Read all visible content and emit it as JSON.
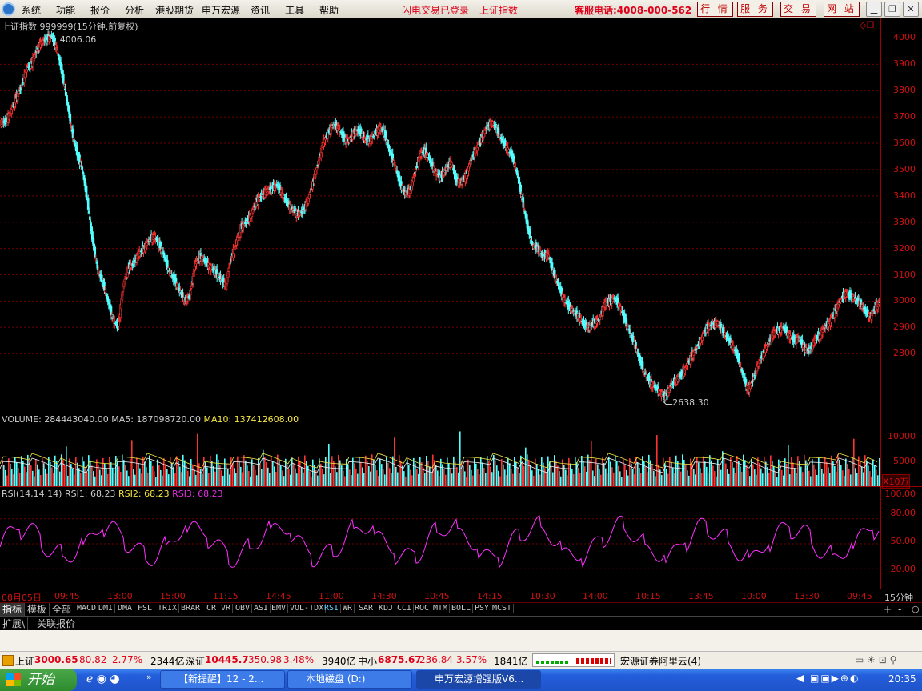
{
  "menubar": {
    "items": [
      "系统",
      "功能",
      "报价",
      "分析",
      "港股期货",
      "申万宏源",
      "资讯",
      "工具",
      "帮助"
    ],
    "login_status": "闪电交易已登录",
    "index_link": "上证指数",
    "hotline": "客服电话:4008-000-562",
    "top_buttons": [
      "行 情",
      "服 务",
      "交 易",
      "网 站"
    ]
  },
  "chart_data": {
    "type": "line",
    "title": "上证指数 999999(15分钟.前复权)",
    "price_ylim": [
      2600,
      4050
    ],
    "price_ticks": [
      "4000",
      "3900",
      "3800",
      "3700",
      "3600",
      "3500",
      "3400",
      "3300",
      "3200",
      "3100",
      "3000",
      "2900",
      "2800"
    ],
    "annotations": [
      {
        "label": "4006.06",
        "value": 4006.06
      },
      {
        "label": "2638.30",
        "value": 2638.3
      }
    ],
    "price_series": [
      3680,
      3720,
      3770,
      3810,
      3880,
      3900,
      3950,
      3985,
      3995,
      4006,
      3960,
      3870,
      3760,
      3640,
      3560,
      3500,
      3380,
      3230,
      3120,
      3070,
      3000,
      2930,
      2900,
      3060,
      3130,
      3140,
      3180,
      3200,
      3230,
      3250,
      3215,
      3170,
      3110,
      3080,
      3040,
      3000,
      3020,
      3140,
      3170,
      3150,
      3130,
      3110,
      3085,
      3060,
      3160,
      3220,
      3280,
      3300,
      3330,
      3380,
      3400,
      3420,
      3430,
      3440,
      3410,
      3370,
      3350,
      3330,
      3340,
      3380,
      3450,
      3520,
      3600,
      3640,
      3670,
      3660,
      3620,
      3610,
      3640,
      3650,
      3620,
      3610,
      3630,
      3660,
      3640,
      3570,
      3520,
      3450,
      3410,
      3420,
      3490,
      3560,
      3570,
      3530,
      3490,
      3470,
      3500,
      3530,
      3460,
      3450,
      3480,
      3540,
      3580,
      3620,
      3660,
      3680,
      3650,
      3610,
      3580,
      3550,
      3480,
      3380,
      3280,
      3210,
      3200,
      3170,
      3180,
      3110,
      3060,
      3010,
      2980,
      2960,
      2940,
      2910,
      2900,
      2920,
      2930,
      2990,
      3000,
      3010,
      2980,
      2930,
      2880,
      2830,
      2770,
      2720,
      2690,
      2670,
      2650,
      2638,
      2680,
      2700,
      2720,
      2750,
      2790,
      2820,
      2860,
      2900,
      2910,
      2920,
      2890,
      2860,
      2830,
      2790,
      2720,
      2660,
      2700,
      2760,
      2800,
      2840,
      2880,
      2890,
      2900,
      2870,
      2850,
      2860,
      2820,
      2810,
      2850,
      2870,
      2900,
      2920,
      2960,
      3000,
      3030,
      3020,
      3010,
      2990,
      2960,
      2940,
      2980,
      3000
    ],
    "volume_header": {
      "label": "VOLUME: 284443040.00",
      "ma5": "MA5: 187098720.00",
      "ma10": "MA10: 137412608.00"
    },
    "volume_ticks": [
      "10000",
      "5000"
    ],
    "volume_unit": "X10万",
    "rsi_header": {
      "label": "RSI(14,14,14)",
      "rsi1": "RSI1: 68.23",
      "rsi2": "RSI2: 68.23",
      "rsi3": "RSI3: 68.23"
    },
    "rsi_ticks": [
      "100.00",
      "80.00",
      "50.00",
      "20.00"
    ],
    "time_ticks": [
      "08月05日",
      "09:45",
      "13:00",
      "15:00",
      "11:15",
      "14:45",
      "11:00",
      "14:30",
      "10:45",
      "14:15",
      "10:30",
      "14:00",
      "10:15",
      "13:45",
      "10:00",
      "13:30",
      "09:45"
    ],
    "period": "15分钟"
  },
  "indicator_tabs": [
    "MACD",
    "DMI",
    "DMA",
    "FSL",
    "TRIX",
    "BRAR",
    "CR",
    "VR",
    "OBV",
    "ASI",
    "EMV",
    "VOL-TDX",
    "RSI",
    "WR",
    "SAR",
    "KDJ",
    "CCI",
    "ROC",
    "MTM",
    "BOLL",
    "PSY",
    "MCST"
  ],
  "left_tabs": [
    "指标",
    "模板",
    "全部"
  ],
  "row2_tabs": [
    "扩展\\",
    "关联报价"
  ],
  "zoom_controls": [
    "+",
    "-",
    "○"
  ],
  "statusbar": {
    "sh_label": "上证",
    "sh_value": "3000.65",
    "sh_change": "80.82",
    "sh_pct": "2.77%",
    "sh_amount": "2344亿",
    "sz_label": "深证",
    "sz_value": "10445.7",
    "sz_change": "350.98",
    "sz_pct": "3.48%",
    "sz_amount": "3940亿",
    "zx_label": "中小",
    "zx_value": "6875.67",
    "zx_change": "236.84",
    "zx_pct": "3.57%",
    "zx_amount": "1841亿",
    "server": "宏源证券阿里云(4)"
  },
  "taskbar": {
    "start": "开始",
    "tasks": [
      "【新提醒】12 - 2...",
      "本地磁盘 (D:)",
      "申万宏源增强版V6..."
    ],
    "clock": "20:35"
  }
}
